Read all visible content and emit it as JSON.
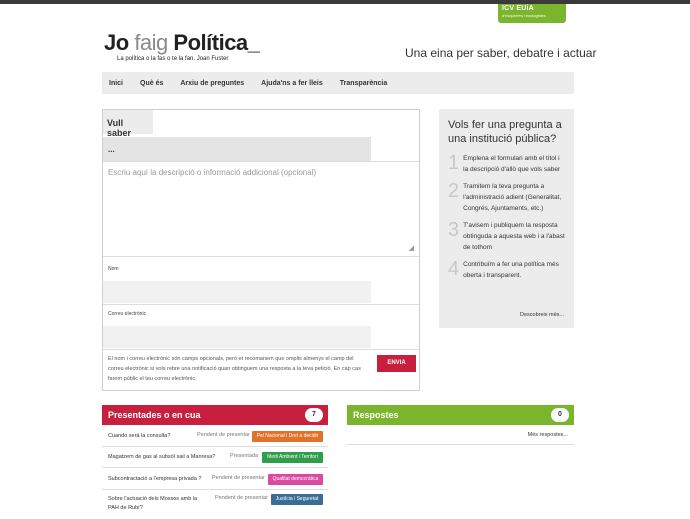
{
  "badge": {
    "line1": "ICV EUiA",
    "line2": "d'esquerres i ecologistes"
  },
  "logo": {
    "jo": "Jo",
    "faig": "faig",
    "politica": "Política_",
    "subtitle": "La política o la fas o te la fan. Joan Fuster"
  },
  "tagline": "Una eina per saber, debatre i actuar",
  "nav": [
    "Inici",
    "Què és",
    "Arxiu de preguntes",
    "Ajuda'ns a fer lleis",
    "Transparència"
  ],
  "form": {
    "title": "Vull saber",
    "title_value": "...",
    "description_placeholder": "Escriu aquí la descripció o informació addicional (opcional)",
    "name_label": "Nom",
    "email_label": "Correu electrònic",
    "note": "El nom i correu electrònic són camps opcionals, però et recomanem que omplis almenys el camp del correu electrònic si vols rebre una notificació quan obtinguem una resposta a la teva petició. En cap cas farem públic el teu correu electrònic.",
    "send_label": "ENVIA"
  },
  "side": {
    "title": "Vols fer una pregunta a una institució pública?",
    "steps": [
      {
        "num": "1",
        "text": "Emplena el formulari amb el títol i la descripció d'allò que vols saber"
      },
      {
        "num": "2",
        "text": "Tramitem la teva pregunta a l'administració adient (Generalitat, Congrés, Ajuntaments, etc.)"
      },
      {
        "num": "3",
        "text": "T'avisem i publiquem la resposta obtinguda a aquesta web i a l'abast de tothom"
      },
      {
        "num": "4",
        "text": "Contribuïm a fer una política més oberta i transparent."
      }
    ],
    "more": "Descobreix més..."
  },
  "presented": {
    "title": "Presentades o en cua",
    "count": "7",
    "rows": [
      {
        "question": "Cuando será la consulta?",
        "status": "Pendent de presentar",
        "tag": "Pel Nacional i Dret a decidir",
        "tag_color": "#e0722a"
      },
      {
        "question": "Magatzem de gas al subsòl sail a Manresa?",
        "status": "Presentada",
        "tag": "Medi Ambient i Territori",
        "tag_color": "#2f9e4a"
      },
      {
        "question": "Subcontractació a l'empresa privada ?",
        "status": "Pendent de presentar",
        "tag": "Qualitat democràtica",
        "tag_color": "#d94aa0"
      },
      {
        "question": "Sobre l'actuació dels Mossos amb la PAH de Rubí?",
        "status": "Pendent de presentar",
        "tag": "Justícia i Seguretat",
        "tag_color": "#3a6d96"
      }
    ]
  },
  "responses": {
    "title": "Respostes",
    "count": "0",
    "more": "Més respostes..."
  }
}
